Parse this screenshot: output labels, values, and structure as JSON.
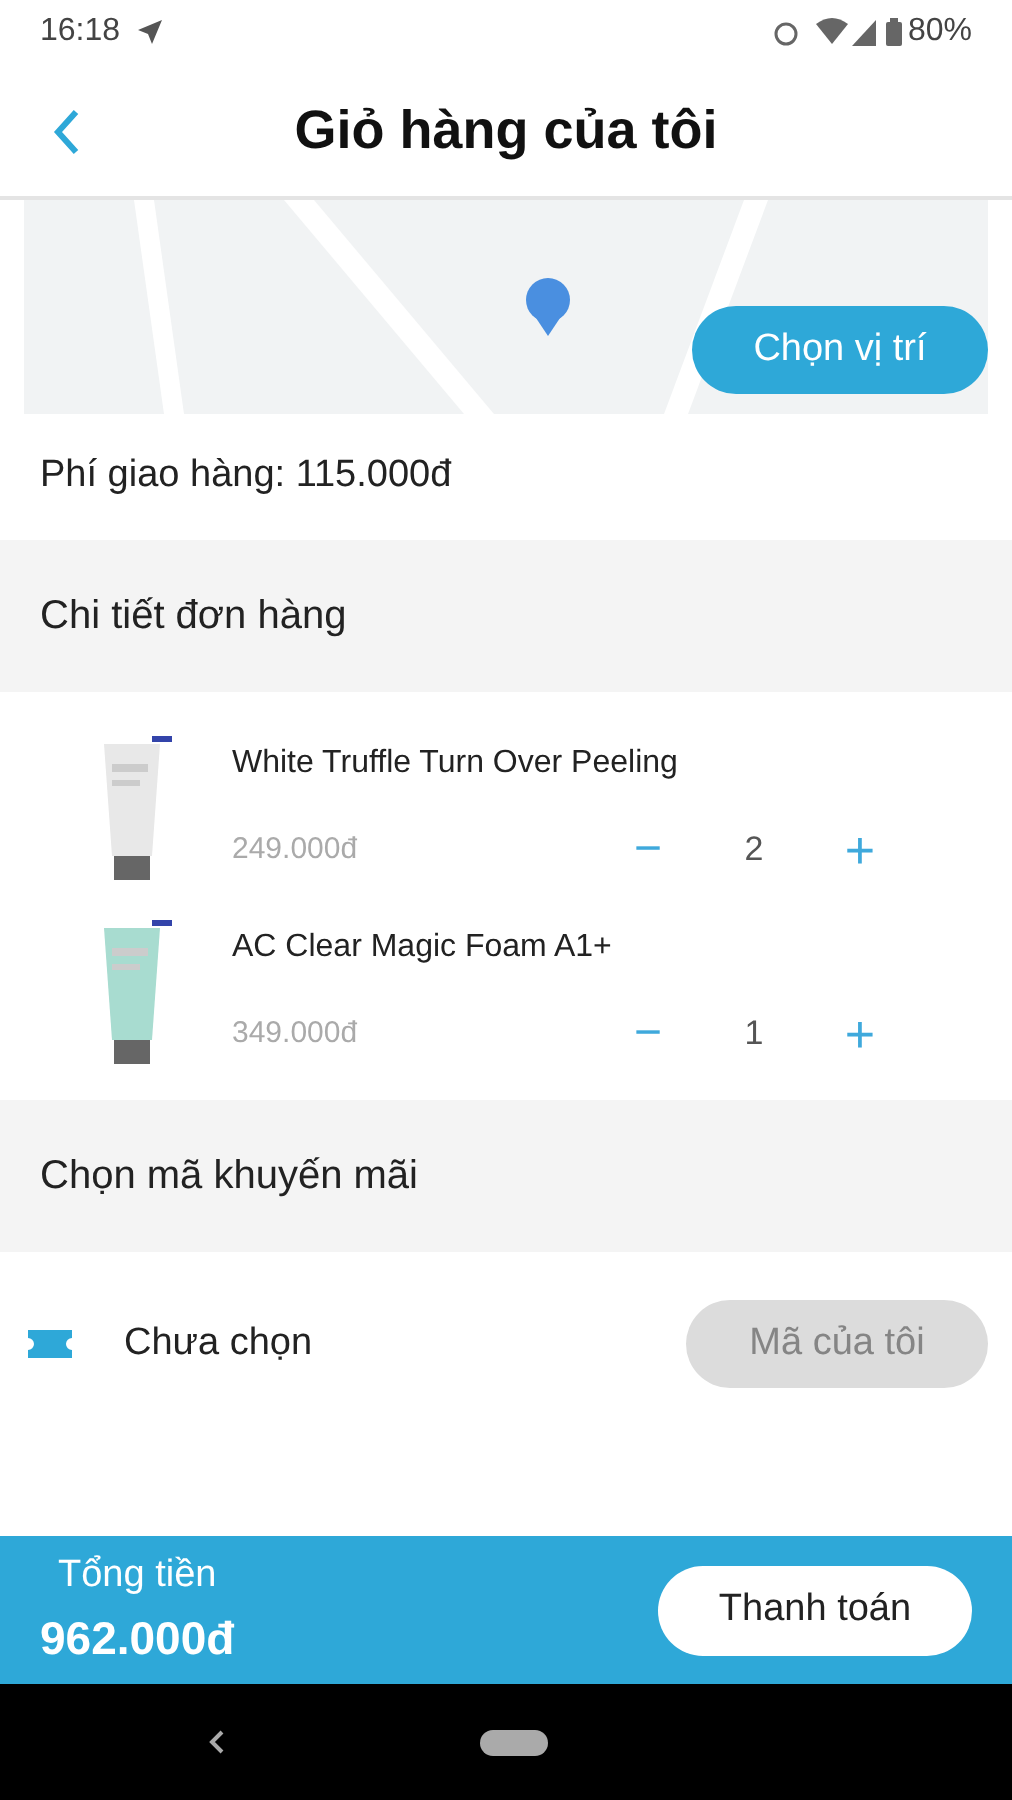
{
  "status_bar": {
    "time": "16:18",
    "battery": "80%"
  },
  "header": {
    "title": "Giỏ hàng của tôi"
  },
  "map": {
    "kind": "picture",
    "button": "Chọn vị trí"
  },
  "shipping_fee": "Phí giao hàng: 115.000đ",
  "order_section": {
    "title": "Chi tiết đơn hàng"
  },
  "items": [
    {
      "name": "White Truffle Turn Over Peeling",
      "price": "249.000đ",
      "quantity": "2",
      "minus": "−",
      "plus": "+",
      "color": "#e8e8e8"
    },
    {
      "name": "AC Clear Magic Foam A1+",
      "price": "349.000đ",
      "quantity": "1",
      "minus": "−",
      "plus": "+",
      "color": "#a8dcd0"
    }
  ],
  "promo_section": {
    "title": "Chọn mã khuyến mãi"
  },
  "promo": {
    "value": "Chưa chọn",
    "button": "Mã của tôi",
    "disabled": true
  },
  "footer": {
    "total_label": "Tổng tiền",
    "total": "962.000đ",
    "checkout": "Thanh toán"
  }
}
